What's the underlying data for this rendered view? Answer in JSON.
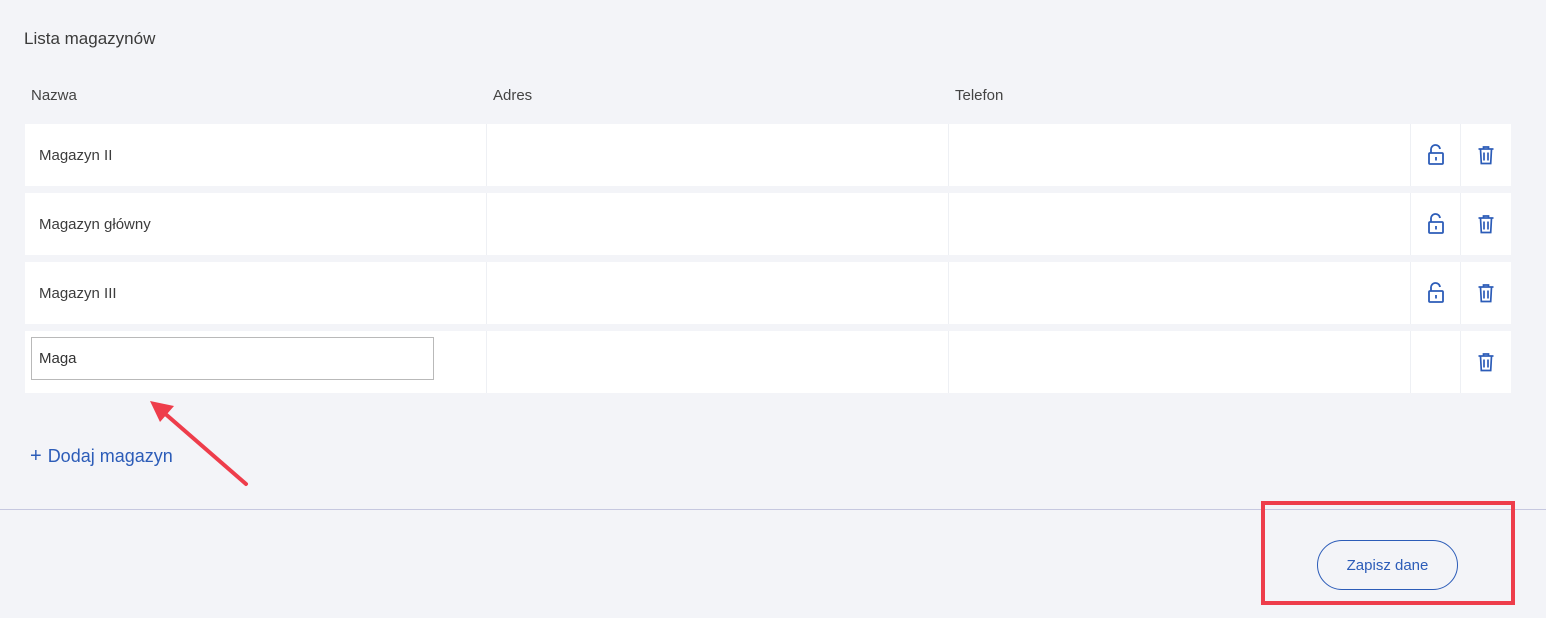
{
  "section": {
    "title": "Lista magazynów"
  },
  "table": {
    "headers": {
      "name": "Nazwa",
      "address": "Adres",
      "phone": "Telefon"
    },
    "rows": [
      {
        "name": "Magazyn II",
        "address": "",
        "phone": ""
      },
      {
        "name": "Magazyn główny",
        "address": "",
        "phone": ""
      },
      {
        "name": "Magazyn III",
        "address": "",
        "phone": ""
      }
    ],
    "new_row": {
      "name_value": "Maga",
      "address": "",
      "phone": ""
    }
  },
  "actions": {
    "add_label": "Dodaj magazyn",
    "add_icon": "plus-icon",
    "save_label": "Zapisz dane",
    "lock_icon": "unlock-icon",
    "delete_icon": "trash-icon"
  },
  "colors": {
    "accent": "#2c5cb8",
    "annotation": "#ee3d4b",
    "background": "#f3f4f8"
  }
}
